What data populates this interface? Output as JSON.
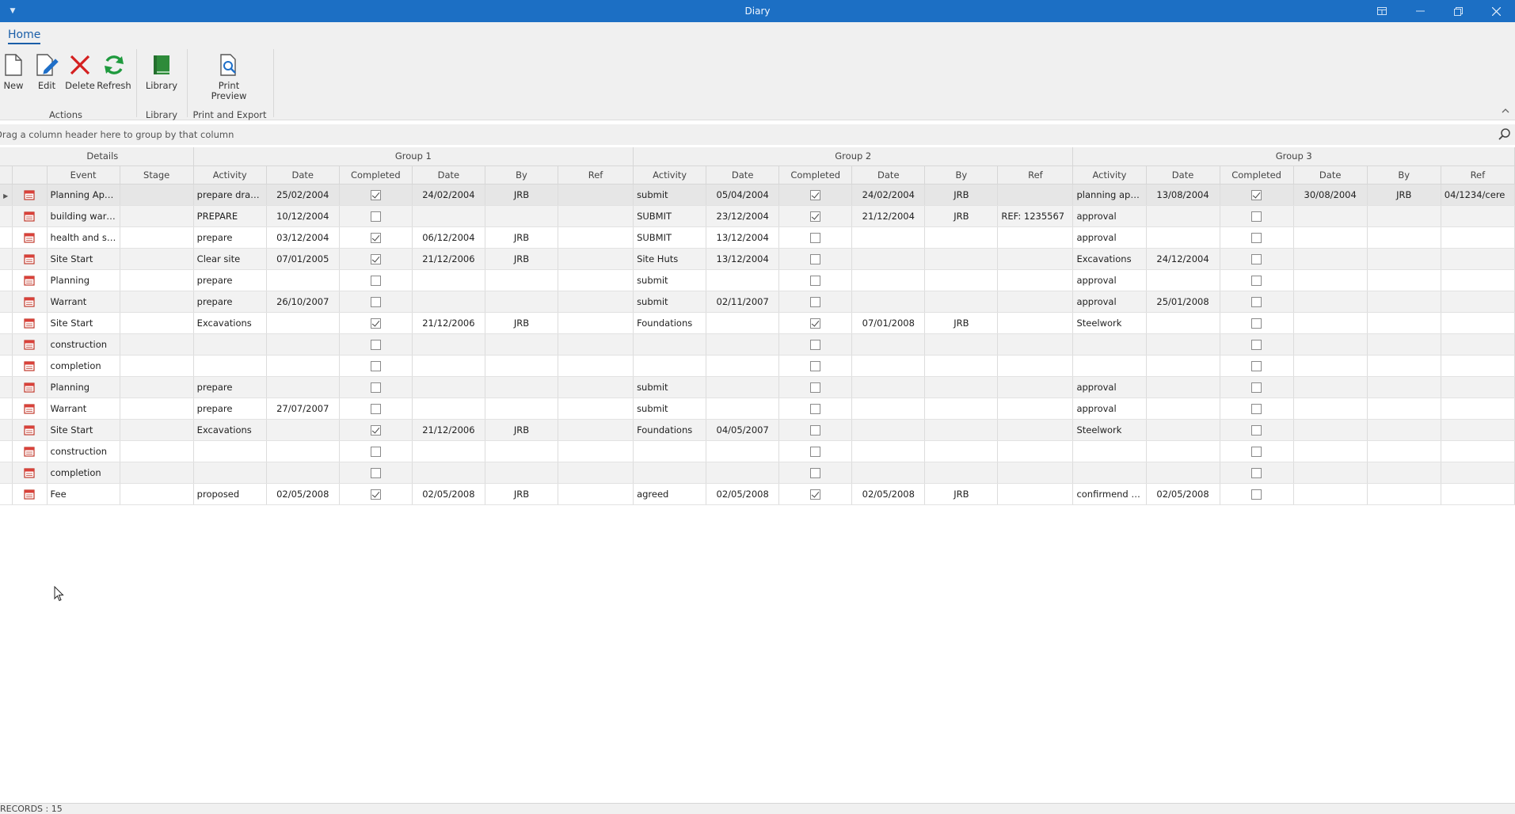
{
  "window": {
    "title": "Diary"
  },
  "ribbon": {
    "tab": "Home",
    "buttons": {
      "new": "New",
      "edit": "Edit",
      "delete": "Delete",
      "refresh": "Refresh",
      "library": "Library",
      "print_preview": "Print Preview"
    },
    "groups": {
      "actions": "Actions",
      "library": "Library",
      "print_export": "Print and Export"
    },
    "colors": {
      "delete": "#d42020",
      "refresh": "#1f9a3e",
      "library": "#2e8b3a",
      "edit": "#1f6fc8"
    }
  },
  "grouppanel": {
    "hint": "Drag a column header here to group by that column"
  },
  "grid": {
    "bands": {
      "details": "Details",
      "group1": "Group 1",
      "group2": "Group 2",
      "group3": "Group 3"
    },
    "columns": {
      "event": "Event",
      "stage": "Stage",
      "activity": "Activity",
      "date": "Date",
      "completed": "Completed",
      "by": "By",
      "ref": "Ref"
    },
    "rows": [
      {
        "event": "Planning Applic...",
        "stage": "",
        "g1_activity": "prepare drawings",
        "g1_date": "25/02/2004",
        "g1_completed": true,
        "g1_cdate": "24/02/2004",
        "g1_by": "JRB",
        "g1_ref": "",
        "g2_activity": "submit",
        "g2_date": "05/04/2004",
        "g2_completed": true,
        "g2_cdate": "24/02/2004",
        "g2_by": "JRB",
        "g2_ref": "",
        "g3_activity": "planning approval",
        "g3_date": "13/08/2004",
        "g3_completed": true,
        "g3_cdate": "30/08/2004",
        "g3_by": "JRB",
        "g3_ref": "04/1234/cere"
      },
      {
        "event": "building warrant",
        "stage": "",
        "g1_activity": "PREPARE",
        "g1_date": "10/12/2004",
        "g1_completed": false,
        "g1_cdate": "",
        "g1_by": "",
        "g1_ref": "",
        "g2_activity": "SUBMIT",
        "g2_date": "23/12/2004",
        "g2_completed": true,
        "g2_cdate": "21/12/2004",
        "g2_by": "JRB",
        "g2_ref": "REF: 1235567",
        "g3_activity": "approval",
        "g3_date": "",
        "g3_completed": false,
        "g3_cdate": "",
        "g3_by": "",
        "g3_ref": ""
      },
      {
        "event": "health and saft...",
        "stage": "",
        "g1_activity": "prepare",
        "g1_date": "03/12/2004",
        "g1_completed": true,
        "g1_cdate": "06/12/2004",
        "g1_by": "JRB",
        "g1_ref": "",
        "g2_activity": "SUBMIT",
        "g2_date": "13/12/2004",
        "g2_completed": false,
        "g2_cdate": "",
        "g2_by": "",
        "g2_ref": "",
        "g3_activity": "approval",
        "g3_date": "",
        "g3_completed": false,
        "g3_cdate": "",
        "g3_by": "",
        "g3_ref": ""
      },
      {
        "event": "Site Start",
        "stage": "",
        "g1_activity": "Clear site",
        "g1_date": "07/01/2005",
        "g1_completed": true,
        "g1_cdate": "21/12/2006",
        "g1_by": "JRB",
        "g1_ref": "",
        "g2_activity": "Site Huts",
        "g2_date": "13/12/2004",
        "g2_completed": false,
        "g2_cdate": "",
        "g2_by": "",
        "g2_ref": "",
        "g3_activity": "Excavations",
        "g3_date": "24/12/2004",
        "g3_completed": false,
        "g3_cdate": "",
        "g3_by": "",
        "g3_ref": ""
      },
      {
        "event": "Planning",
        "stage": "",
        "g1_activity": "prepare",
        "g1_date": "",
        "g1_completed": false,
        "g1_cdate": "",
        "g1_by": "",
        "g1_ref": "",
        "g2_activity": "submit",
        "g2_date": "",
        "g2_completed": false,
        "g2_cdate": "",
        "g2_by": "",
        "g2_ref": "",
        "g3_activity": "approval",
        "g3_date": "",
        "g3_completed": false,
        "g3_cdate": "",
        "g3_by": "",
        "g3_ref": ""
      },
      {
        "event": "Warrant",
        "stage": "",
        "g1_activity": "prepare",
        "g1_date": "26/10/2007",
        "g1_completed": false,
        "g1_cdate": "",
        "g1_by": "",
        "g1_ref": "",
        "g2_activity": "submit",
        "g2_date": "02/11/2007",
        "g2_completed": false,
        "g2_cdate": "",
        "g2_by": "",
        "g2_ref": "",
        "g3_activity": "approval",
        "g3_date": "25/01/2008",
        "g3_completed": false,
        "g3_cdate": "",
        "g3_by": "",
        "g3_ref": ""
      },
      {
        "event": "Site Start",
        "stage": "",
        "g1_activity": "Excavations",
        "g1_date": "",
        "g1_completed": true,
        "g1_cdate": "21/12/2006",
        "g1_by": "JRB",
        "g1_ref": "",
        "g2_activity": "Foundations",
        "g2_date": "",
        "g2_completed": true,
        "g2_cdate": "07/01/2008",
        "g2_by": "JRB",
        "g2_ref": "",
        "g3_activity": "Steelwork",
        "g3_date": "",
        "g3_completed": false,
        "g3_cdate": "",
        "g3_by": "",
        "g3_ref": ""
      },
      {
        "event": "construction",
        "stage": "",
        "g1_activity": "",
        "g1_date": "",
        "g1_completed": false,
        "g1_cdate": "",
        "g1_by": "",
        "g1_ref": "",
        "g2_activity": "",
        "g2_date": "",
        "g2_completed": false,
        "g2_cdate": "",
        "g2_by": "",
        "g2_ref": "",
        "g3_activity": "",
        "g3_date": "",
        "g3_completed": false,
        "g3_cdate": "",
        "g3_by": "",
        "g3_ref": ""
      },
      {
        "event": "completion",
        "stage": "",
        "g1_activity": "",
        "g1_date": "",
        "g1_completed": false,
        "g1_cdate": "",
        "g1_by": "",
        "g1_ref": "",
        "g2_activity": "",
        "g2_date": "",
        "g2_completed": false,
        "g2_cdate": "",
        "g2_by": "",
        "g2_ref": "",
        "g3_activity": "",
        "g3_date": "",
        "g3_completed": false,
        "g3_cdate": "",
        "g3_by": "",
        "g3_ref": ""
      },
      {
        "event": "Planning",
        "stage": "",
        "g1_activity": "prepare",
        "g1_date": "",
        "g1_completed": false,
        "g1_cdate": "",
        "g1_by": "",
        "g1_ref": "",
        "g2_activity": "submit",
        "g2_date": "",
        "g2_completed": false,
        "g2_cdate": "",
        "g2_by": "",
        "g2_ref": "",
        "g3_activity": "approval",
        "g3_date": "",
        "g3_completed": false,
        "g3_cdate": "",
        "g3_by": "",
        "g3_ref": ""
      },
      {
        "event": "Warrant",
        "stage": "",
        "g1_activity": "prepare",
        "g1_date": "27/07/2007",
        "g1_completed": false,
        "g1_cdate": "",
        "g1_by": "",
        "g1_ref": "",
        "g2_activity": "submit",
        "g2_date": "",
        "g2_completed": false,
        "g2_cdate": "",
        "g2_by": "",
        "g2_ref": "",
        "g3_activity": "approval",
        "g3_date": "",
        "g3_completed": false,
        "g3_cdate": "",
        "g3_by": "",
        "g3_ref": ""
      },
      {
        "event": "Site Start",
        "stage": "",
        "g1_activity": "Excavations",
        "g1_date": "",
        "g1_completed": true,
        "g1_cdate": "21/12/2006",
        "g1_by": "JRB",
        "g1_ref": "",
        "g2_activity": "Foundations",
        "g2_date": "04/05/2007",
        "g2_completed": false,
        "g2_cdate": "",
        "g2_by": "",
        "g2_ref": "",
        "g3_activity": "Steelwork",
        "g3_date": "",
        "g3_completed": false,
        "g3_cdate": "",
        "g3_by": "",
        "g3_ref": ""
      },
      {
        "event": "construction",
        "stage": "",
        "g1_activity": "",
        "g1_date": "",
        "g1_completed": false,
        "g1_cdate": "",
        "g1_by": "",
        "g1_ref": "",
        "g2_activity": "",
        "g2_date": "",
        "g2_completed": false,
        "g2_cdate": "",
        "g2_by": "",
        "g2_ref": "",
        "g3_activity": "",
        "g3_date": "",
        "g3_completed": false,
        "g3_cdate": "",
        "g3_by": "",
        "g3_ref": ""
      },
      {
        "event": "completion",
        "stage": "",
        "g1_activity": "",
        "g1_date": "",
        "g1_completed": false,
        "g1_cdate": "",
        "g1_by": "",
        "g1_ref": "",
        "g2_activity": "",
        "g2_date": "",
        "g2_completed": false,
        "g2_cdate": "",
        "g2_by": "",
        "g2_ref": "",
        "g3_activity": "",
        "g3_date": "",
        "g3_completed": false,
        "g3_cdate": "",
        "g3_by": "",
        "g3_ref": ""
      },
      {
        "event": "Fee",
        "stage": "",
        "g1_activity": "proposed",
        "g1_date": "02/05/2008",
        "g1_completed": true,
        "g1_cdate": "02/05/2008",
        "g1_by": "JRB",
        "g1_ref": "",
        "g2_activity": "agreed",
        "g2_date": "02/05/2008",
        "g2_completed": true,
        "g2_cdate": "02/05/2008",
        "g2_by": "JRB",
        "g2_ref": "",
        "g3_activity": "confirmend - ad...",
        "g3_date": "02/05/2008",
        "g3_completed": false,
        "g3_cdate": "",
        "g3_by": "",
        "g3_ref": ""
      }
    ]
  },
  "status": {
    "records": "RECORDS : 15"
  },
  "icons": {
    "row_icon": "calendar-icon",
    "search": "search-icon"
  }
}
